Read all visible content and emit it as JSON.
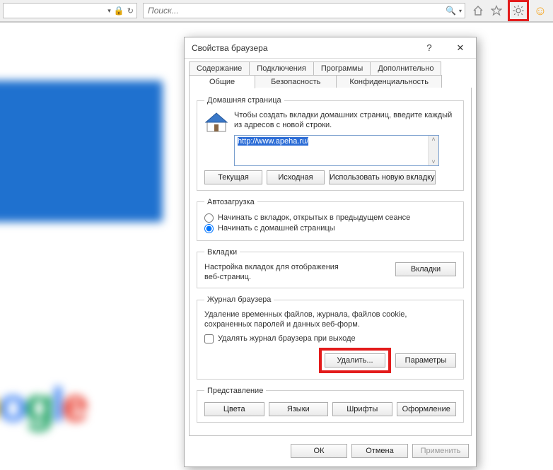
{
  "topbar": {
    "search_placeholder": "Поиск..."
  },
  "dialog": {
    "title": "Свойства браузера",
    "tabs_top": [
      "Содержание",
      "Подключения",
      "Программы",
      "Дополнительно"
    ],
    "tabs_bottom": [
      "Общие",
      "Безопасность",
      "Конфиденциальность"
    ],
    "active_tab": "Общие"
  },
  "homepage": {
    "legend": "Домашняя страница",
    "help_text": "Чтобы создать вкладки домашних страниц, введите каждый из адресов с новой строки.",
    "url": "http://www.apeha.ru/",
    "buttons": {
      "current": "Текущая",
      "default": "Исходная",
      "new_tab": "Использовать новую вкладку"
    }
  },
  "startup": {
    "legend": "Автозагрузка",
    "opt_tabs": "Начинать с вкладок, открытых в предыдущем сеансе",
    "opt_home": "Начинать с домашней страницы"
  },
  "tabs_group": {
    "legend": "Вкладки",
    "desc": "Настройка вкладок для отображения веб-страниц.",
    "button": "Вкладки"
  },
  "history": {
    "legend": "Журнал браузера",
    "desc": "Удаление временных файлов, журнала, файлов cookie, сохраненных паролей и данных веб-форм.",
    "check_label": "Удалять журнал браузера при выходе",
    "delete_btn": "Удалить...",
    "settings_btn": "Параметры"
  },
  "appearance": {
    "legend": "Представление",
    "colors": "Цвета",
    "languages": "Языки",
    "fonts": "Шрифты",
    "accessibility": "Оформление"
  },
  "footer": {
    "ok": "ОК",
    "cancel": "Отмена",
    "apply": "Применить"
  }
}
